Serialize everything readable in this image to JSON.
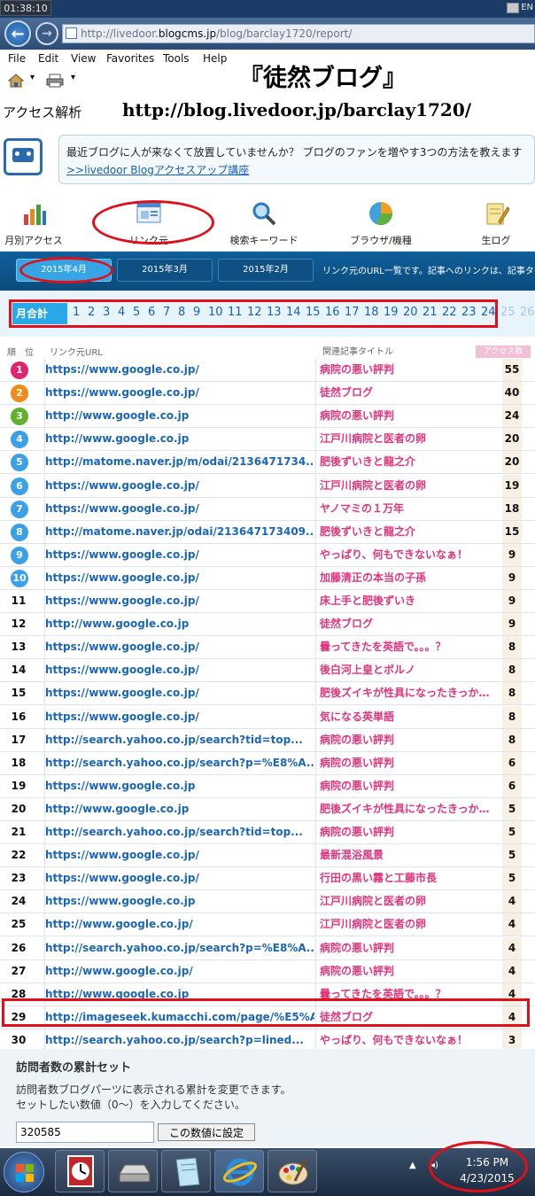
{
  "status": {
    "time": "01:38:10",
    "lang": "EN"
  },
  "browser": {
    "back_symbol": "←",
    "forward_symbol": "→",
    "url_prefix": "http://livedoor.",
    "url_domain": "blogcms.jp",
    "url_path": "/blog/barclay1720/report/",
    "menu": [
      "File",
      "Edit",
      "View",
      "Favorites",
      "Tools",
      "Help"
    ]
  },
  "page": {
    "blog_title": "『徒然ブログ』",
    "access_label": "アクセス解析",
    "blog_url": "http://blog.livedoor.jp/barclay1720/"
  },
  "promo": {
    "text": "最近ブログに人が来なくて放置していませんか？ ブログのファンを増やす3つの方法を教えます",
    "link": ">>livedoor Blogアクセスアップ講座"
  },
  "categories": [
    "月別アクセス",
    "リンク元",
    "検索キーワード",
    "ブラウザ/機種",
    "生ログ"
  ],
  "months": [
    "2015年4月",
    "2015年3月",
    "2015年2月"
  ],
  "month_note": "リンク元のURL一覧です。記事へのリンクは、記事タイトルも表示",
  "days": {
    "total_label": "月合計",
    "active": [
      "1",
      "2",
      "3",
      "4",
      "5",
      "6",
      "7",
      "8",
      "9",
      "10",
      "11",
      "12",
      "13",
      "14",
      "15",
      "16",
      "17",
      "18",
      "19",
      "20",
      "21",
      "22",
      "23",
      "24"
    ],
    "inactive": [
      "25",
      "26"
    ]
  },
  "table": {
    "headers": {
      "rank": "順　位",
      "url": "リンク元URL",
      "title": "関連記事タイトル",
      "count": "アクセス数"
    },
    "rows": [
      {
        "rank": "1",
        "url": "https://www.google.co.jp/",
        "title": "病院の悪い評判",
        "count": "55"
      },
      {
        "rank": "2",
        "url": "https://www.google.co.jp/",
        "title": "徒然ブログ",
        "count": "40"
      },
      {
        "rank": "3",
        "url": "http://www.google.co.jp",
        "title": "病院の悪い評判",
        "count": "24"
      },
      {
        "rank": "4",
        "url": "http://www.google.co.jp",
        "title": "江戸川病院と医者の卵",
        "count": "20"
      },
      {
        "rank": "5",
        "url": "http://matome.naver.jp/m/odai/2136471734...",
        "title": "肥後ずいきと龍之介",
        "count": "20"
      },
      {
        "rank": "6",
        "url": "https://www.google.co.jp/",
        "title": "江戸川病院と医者の卵",
        "count": "19"
      },
      {
        "rank": "7",
        "url": "https://www.google.co.jp/",
        "title": "ヤノマミの１万年",
        "count": "18"
      },
      {
        "rank": "8",
        "url": "http://matome.naver.jp/odai/213647173409...",
        "title": "肥後ずいきと龍之介",
        "count": "15"
      },
      {
        "rank": "9",
        "url": "https://www.google.co.jp/",
        "title": "やっぱり、何もできないなぁ！",
        "count": "9"
      },
      {
        "rank": "10",
        "url": "https://www.google.co.jp/",
        "title": "加藤清正の本当の子孫",
        "count": "9"
      },
      {
        "rank": "11",
        "url": "https://www.google.co.jp/",
        "title": "床上手と肥後ずいき",
        "count": "9"
      },
      {
        "rank": "12",
        "url": "http://www.google.co.jp",
        "title": "徒然ブログ",
        "count": "9"
      },
      {
        "rank": "13",
        "url": "https://www.google.co.jp/",
        "title": "曇ってきたを英語で。。。？",
        "count": "8"
      },
      {
        "rank": "14",
        "url": "https://www.google.co.jp/",
        "title": "後白河上皇とボルノ",
        "count": "8"
      },
      {
        "rank": "15",
        "url": "https://www.google.co.jp/",
        "title": "肥後ズイキが性具になったきっか…",
        "count": "8"
      },
      {
        "rank": "16",
        "url": "https://www.google.co.jp/",
        "title": "気になる英単語",
        "count": "8"
      },
      {
        "rank": "17",
        "url": "http://search.yahoo.co.jp/search?tid=top...",
        "title": "病院の悪い評判",
        "count": "8"
      },
      {
        "rank": "18",
        "url": "http://search.yahoo.co.jp/search?p=%E8%A...",
        "title": "病院の悪い評判",
        "count": "6"
      },
      {
        "rank": "19",
        "url": "https://www.google.co.jp",
        "title": "病院の悪い評判",
        "count": "6"
      },
      {
        "rank": "20",
        "url": "http://www.google.co.jp",
        "title": "肥後ズイキが性具になったきっか…",
        "count": "5"
      },
      {
        "rank": "21",
        "url": "http://search.yahoo.co.jp/search?tid=top...",
        "title": "病院の悪い評判",
        "count": "5"
      },
      {
        "rank": "22",
        "url": "https://www.google.co.jp/",
        "title": "最新混浴風景",
        "count": "5"
      },
      {
        "rank": "23",
        "url": "https://www.google.co.jp/",
        "title": "行田の黒い霧と工藤市長",
        "count": "5"
      },
      {
        "rank": "24",
        "url": "https://www.google.co.jp",
        "title": "江戸川病院と医者の卵",
        "count": "4"
      },
      {
        "rank": "25",
        "url": "http://www.google.co.jp/",
        "title": "江戸川病院と医者の卵",
        "count": "4"
      },
      {
        "rank": "26",
        "url": "http://search.yahoo.co.jp/search?p=%E8%A...",
        "title": "病院の悪い評判",
        "count": "4"
      },
      {
        "rank": "27",
        "url": "http://www.google.co.jp/",
        "title": "病院の悪い評判",
        "count": "4"
      },
      {
        "rank": "28",
        "url": "http://www.google.co.jp",
        "title": "曇ってきたを英語で。。。？",
        "count": "4"
      },
      {
        "rank": "29",
        "url": "http://imageseek.kumacchi.com/page/%E5%A...",
        "title": "徒然ブログ",
        "count": "4"
      },
      {
        "rank": "30",
        "url": "http://search.yahoo.co.jp/search?p=lined...",
        "title": "やっぱり、何もできないなぁ！",
        "count": "3"
      }
    ],
    "badge_colors": [
      "#e0246e",
      "#f08a1a",
      "#5fb12e",
      "#3aa0e8",
      "#3aa0e8",
      "#3aa0e8",
      "#3aa0e8",
      "#3aa0e8",
      "#3aa0e8",
      "#3aa0e8"
    ]
  },
  "visitors": {
    "heading": "訪問者数の累計セット",
    "desc1": "訪問者数ブログパーツに表示される累計を変更できます。",
    "desc2": "セットしたい数値（0～）を入力してください。",
    "value": "320585",
    "button": "この数値に設定"
  },
  "taskbar": {
    "time": "1:56 PM",
    "date": "4/23/2015"
  }
}
